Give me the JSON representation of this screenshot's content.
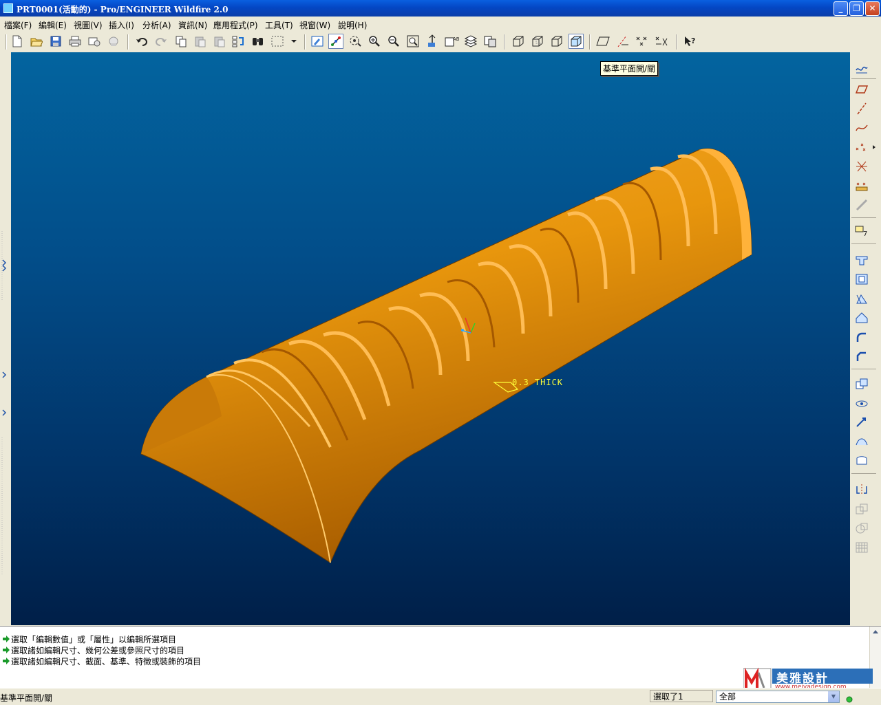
{
  "window": {
    "title": "PRT0001(活動的) - Pro/ENGINEER Wildfire 2.0"
  },
  "menu": [
    "檔案(F)",
    "編輯(E)",
    "視圖(V)",
    "插入(I)",
    "分析(A)",
    "資訊(N)",
    "應用程式(P)",
    "工具(T)",
    "視窗(W)",
    "說明(H)"
  ],
  "tooltip": "基準平面開/關",
  "model": {
    "annotation": "0.3 THICK"
  },
  "messages": [
    "選取「編輯數值」或「屬性」以編輯所選項目",
    "選取諸如編輯尺寸、幾何公差或參照尺寸的項目",
    "選取諸如編輯尺寸、截面、基準、特徵或裝飾的項目"
  ],
  "status": {
    "text": "基準平面開/關",
    "selected": "選取了1",
    "filter": "全部"
  },
  "logo": {
    "brand": "美雅設計",
    "url": "www.meiyadesign.com"
  },
  "colors": {
    "model": "#e8960d",
    "background_top": "#03649f",
    "background_bottom": "#001f48",
    "annotation": "#ffff3a"
  }
}
